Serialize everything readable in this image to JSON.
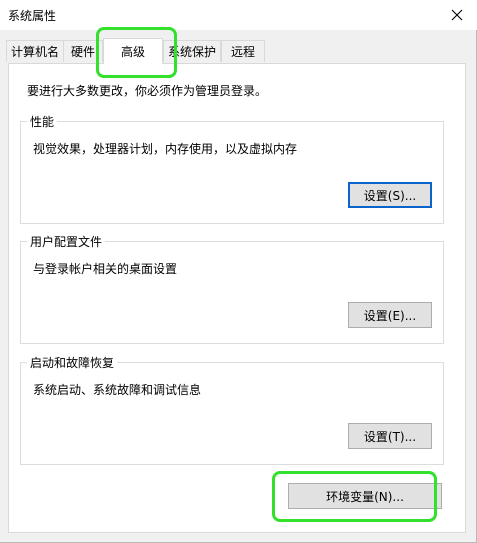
{
  "window": {
    "title": "系统属性"
  },
  "tabs": [
    {
      "label": "计算机名"
    },
    {
      "label": "硬件"
    },
    {
      "label": "高级"
    },
    {
      "label": "系统保护"
    },
    {
      "label": "远程"
    }
  ],
  "notice": "要进行大多数更改，你必须作为管理员登录。",
  "groups": {
    "performance": {
      "title": "性能",
      "desc": "视觉效果，处理器计划，内存使用，以及虚拟内存",
      "button": "设置(S)..."
    },
    "profiles": {
      "title": "用户配置文件",
      "desc": "与登录帐户相关的桌面设置",
      "button": "设置(E)..."
    },
    "startup": {
      "title": "启动和故障恢复",
      "desc": "系统启动、系统故障和调试信息",
      "button": "设置(T)..."
    }
  },
  "env_button": "环境变量(N)...",
  "highlight_color": "#33e02c",
  "focus_color": "#0a64cc"
}
